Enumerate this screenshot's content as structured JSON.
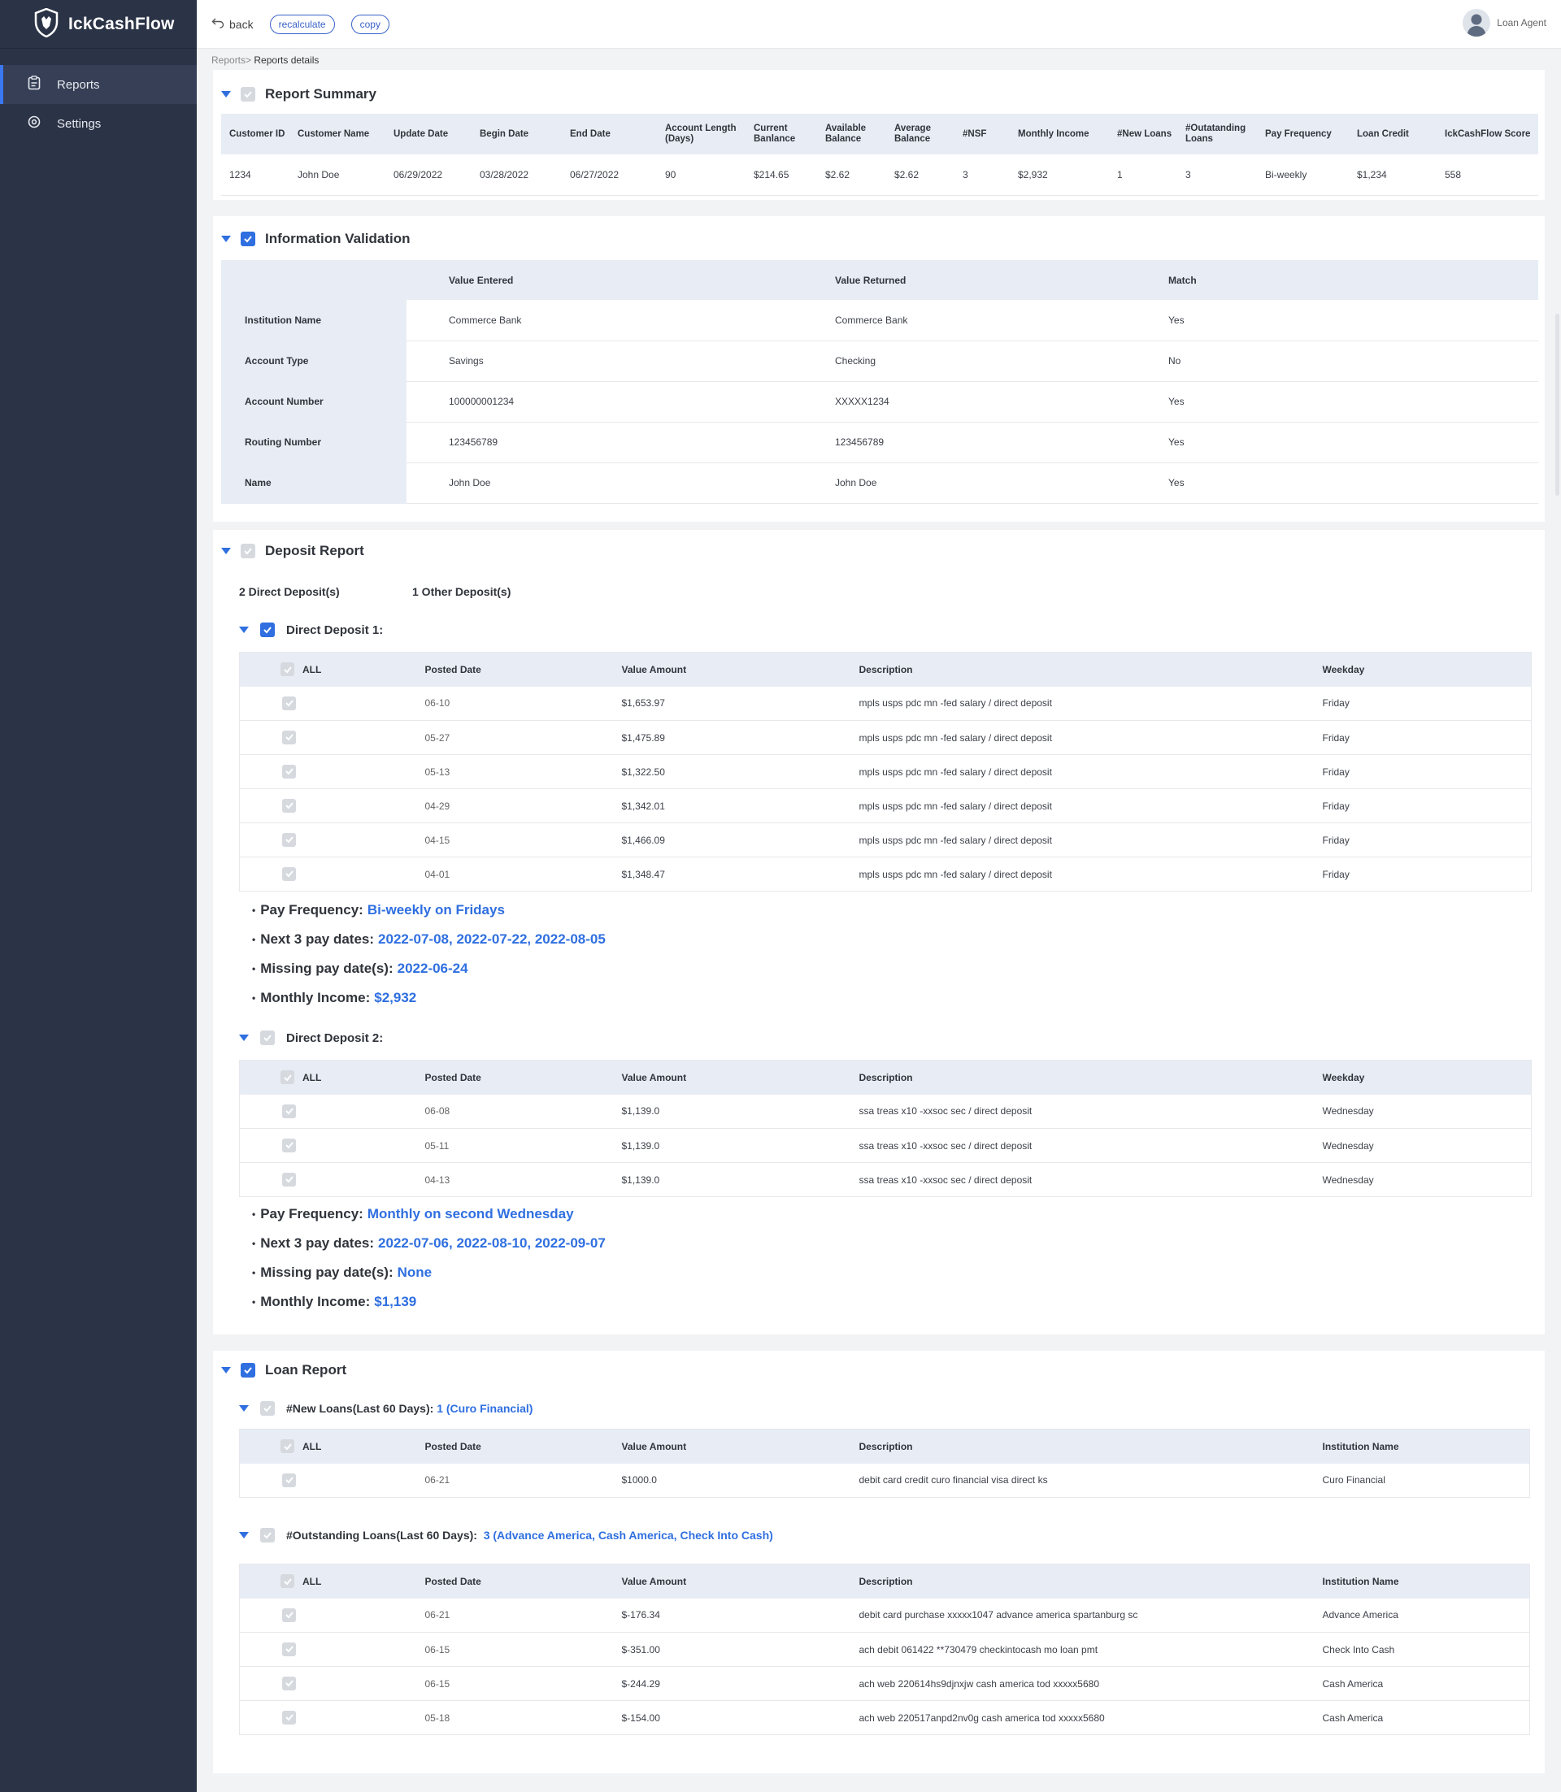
{
  "app": {
    "name": "IckCashFlow"
  },
  "sidebar": {
    "items": [
      {
        "label": "Reports"
      },
      {
        "label": "Settings"
      }
    ]
  },
  "topbar": {
    "back": "back",
    "recalculate": "recalculate",
    "copy": "copy",
    "user": "Loan Agent"
  },
  "breadcrumb": {
    "parent": "Reports>",
    "current": "Reports details"
  },
  "summary": {
    "title": "Report Summary",
    "headers": [
      "Customer ID",
      "Customer Name",
      "Update  Date",
      "Begin Date",
      "End Date",
      "Account Length (Days)",
      "Current Banlance",
      "Available Balance",
      "Average Balance",
      "#NSF",
      "Monthly Income",
      "#New Loans",
      "#Outatanding Loans",
      "Pay Frequency",
      "Loan Credit",
      "IckCashFlow Score"
    ],
    "values": [
      "1234",
      "John Doe",
      "06/29/2022",
      "03/28/2022",
      "06/27/2022",
      "90",
      "$214.65",
      "$2.62",
      "$2.62",
      "3",
      "$2,932",
      "1",
      "3",
      "Bi-weekly",
      "$1,234",
      "558"
    ]
  },
  "validation": {
    "title": "Information Validation",
    "headers": [
      "Value Entered",
      "Value Returned",
      "Match"
    ],
    "rows": [
      {
        "label": "Institution Name",
        "entered": "Commerce Bank",
        "returned": "Commerce Bank",
        "match": "Yes"
      },
      {
        "label": "Account Type",
        "entered": "Savings",
        "returned": "Checking",
        "match": "No"
      },
      {
        "label": "Account Number",
        "entered": "100000001234",
        "returned": "XXXXX1234",
        "match": "Yes"
      },
      {
        "label": "Routing Number",
        "entered": "123456789",
        "returned": "123456789",
        "match": "Yes"
      },
      {
        "label": "Name",
        "entered": "John Doe",
        "returned": "John Doe",
        "match": "Yes"
      }
    ]
  },
  "deposit": {
    "title": "Deposit Report",
    "direct_count": "2 Direct Deposit(s)",
    "other_count": "1 Other Deposit(s)",
    "headers": [
      "ALL",
      "Posted Date",
      "Value Amount",
      "Description",
      "Weekday"
    ],
    "groups": [
      {
        "title": "Direct Deposit 1:",
        "rows": [
          {
            "date": "06-10",
            "amount": "$1,653.97",
            "desc": "mpls usps pdc mn -fed salary / direct deposit",
            "day": "Friday"
          },
          {
            "date": "05-27",
            "amount": "$1,475.89",
            "desc": "mpls usps pdc mn -fed salary / direct deposit",
            "day": "Friday"
          },
          {
            "date": "05-13",
            "amount": "$1,322.50",
            "desc": "mpls usps pdc mn -fed salary / direct deposit",
            "day": "Friday"
          },
          {
            "date": "04-29",
            "amount": "$1,342.01",
            "desc": "mpls usps pdc mn -fed salary / direct deposit",
            "day": "Friday"
          },
          {
            "date": "04-15",
            "amount": "$1,466.09",
            "desc": "mpls usps pdc mn -fed salary / direct deposit",
            "day": "Friday"
          },
          {
            "date": "04-01",
            "amount": "$1,348.47",
            "desc": "mpls usps pdc mn -fed salary / direct deposit",
            "day": "Friday"
          }
        ],
        "info": [
          {
            "label": "Pay Frequency:",
            "value": "Bi-weekly on Fridays"
          },
          {
            "label": "Next 3 pay dates:",
            "value": "2022-07-08, 2022-07-22, 2022-08-05"
          },
          {
            "label": "Missing pay date(s):",
            "value": "2022-06-24"
          },
          {
            "label": "Monthly Income:",
            "value": "$2,932"
          }
        ]
      },
      {
        "title": "Direct Deposit 2:",
        "rows": [
          {
            "date": "06-08",
            "amount": "$1,139.0",
            "desc": "ssa treas x10 -xxsoc sec / direct deposit",
            "day": "Wednesday"
          },
          {
            "date": "05-11",
            "amount": "$1,139.0",
            "desc": "ssa treas x10 -xxsoc sec / direct deposit",
            "day": "Wednesday"
          },
          {
            "date": "04-13",
            "amount": "$1,139.0",
            "desc": "ssa treas x10 -xxsoc sec / direct deposit",
            "day": "Wednesday"
          }
        ],
        "info": [
          {
            "label": "Pay Frequency:",
            "value": "Monthly on second Wednesday"
          },
          {
            "label": "Next 3 pay dates:",
            "value": "2022-07-06, 2022-08-10, 2022-09-07"
          },
          {
            "label": "Missing pay date(s):",
            "value": "None"
          },
          {
            "label": "Monthly Income:",
            "value": "$1,139"
          }
        ]
      }
    ]
  },
  "loans": {
    "title": "Loan Report",
    "headers": [
      "ALL",
      "Posted Date",
      "Value Amount",
      "Description",
      "Institution Name"
    ],
    "new": {
      "title": "#New Loans(Last 60 Days):",
      "summary": "1 (Curo Financial)",
      "rows": [
        {
          "date": "06-21",
          "amount": "$1000.0",
          "desc": "debit card credit curo financial visa direct ks",
          "inst": "Curo Financial"
        }
      ]
    },
    "outstanding": {
      "title": "#Outstanding Loans(Last 60 Days):",
      "summary": "3 (Advance America, Cash America, Check Into Cash)",
      "rows": [
        {
          "date": "06-21",
          "amount": "$-176.34",
          "desc": "debit card purchase xxxxx1047 advance america spartanburg sc",
          "inst": "Advance America"
        },
        {
          "date": "06-15",
          "amount": "$-351.00",
          "desc": "ach debit 061422 **730479 checkintocash mo loan pmt",
          "inst": "Check Into Cash"
        },
        {
          "date": "06-15",
          "amount": "$-244.29",
          "desc": "ach web 220614hs9djnxjw cash america tod xxxxx5680",
          "inst": "Cash America"
        },
        {
          "date": "05-18",
          "amount": "$-154.00",
          "desc": "ach web 220517anpd2nv0g cash america tod xxxxx5680",
          "inst": "Cash America"
        }
      ]
    }
  }
}
